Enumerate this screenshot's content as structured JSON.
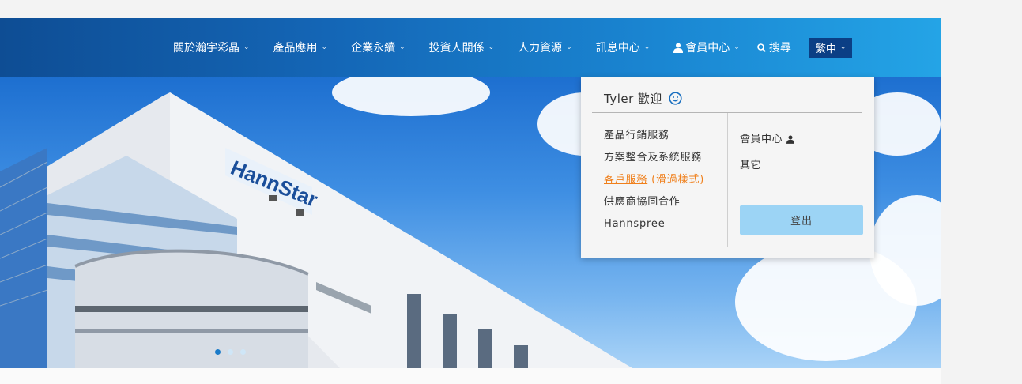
{
  "nav": {
    "items": [
      {
        "label": "關於瀚宇彩晶"
      },
      {
        "label": "產品應用"
      },
      {
        "label": "企業永續"
      },
      {
        "label": "投資人關係"
      },
      {
        "label": "人力資源"
      },
      {
        "label": "訊息中心"
      }
    ],
    "member_label": "會員中心",
    "search_label": "搜尋",
    "lang_label": "繁中",
    "caret": "⌄"
  },
  "hero": {
    "logo_text": "HannStar",
    "slide_count": 3,
    "active_slide": 1
  },
  "dropdown": {
    "welcome_user": "Tyler",
    "welcome_text": "歡迎",
    "left_links": [
      {
        "label": "產品行銷服務",
        "note": ""
      },
      {
        "label": "方案整合及系統服務",
        "note": ""
      },
      {
        "label": "客戶服務",
        "note": "(滑過樣式)"
      },
      {
        "label": "供應商協同合作",
        "note": ""
      },
      {
        "label": "Hannspree",
        "note": ""
      }
    ],
    "right_links": [
      {
        "label": "會員中心"
      },
      {
        "label": "其它"
      }
    ],
    "logout_label": "登出"
  },
  "colors": {
    "nav_gradient_start": "#0e4d94",
    "nav_gradient_end": "#24a4e6",
    "lang_bg": "#0b3f85",
    "hover_orange": "#f07f1a",
    "logout_bg": "#9cd4f5"
  }
}
